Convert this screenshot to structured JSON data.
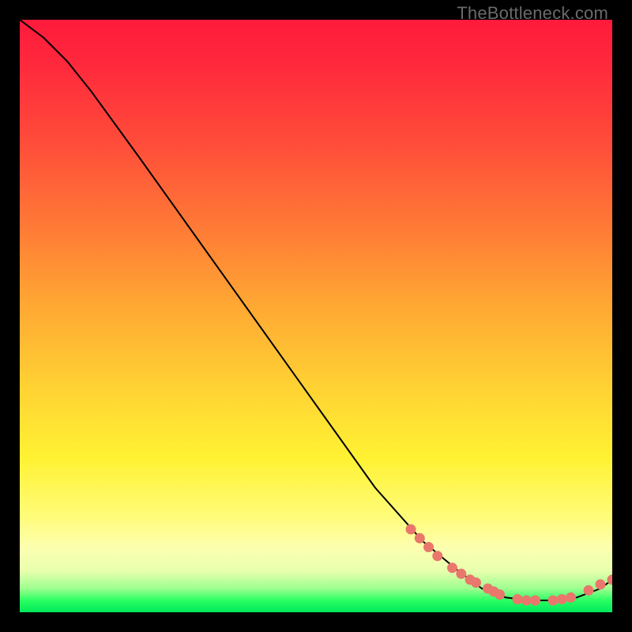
{
  "watermark": "TheBottleneck.com",
  "colors": {
    "curve": "#000000",
    "dot": "#e9776b",
    "gradient_top": "#ff1a3c",
    "gradient_bottom": "#00e85a"
  },
  "chart_data": {
    "type": "line",
    "title": "",
    "xlabel": "",
    "ylabel": "",
    "xlim": [
      0,
      100
    ],
    "ylim": [
      0,
      100
    ],
    "note": "Axis values are pixel-percent positions within the 750×750 plot (top-left origin, y increases downward). No tick labels are rendered.",
    "series": [
      {
        "name": "curve",
        "kind": "line",
        "x": [
          0,
          4,
          8,
          12,
          20,
          30,
          40,
          50,
          60,
          68,
          74,
          78,
          82,
          86,
          90,
          94,
          98,
          100
        ],
        "y": [
          0,
          3,
          7,
          12,
          23,
          37,
          51,
          65,
          79,
          88,
          93,
          96,
          97.5,
          98,
          98,
          97.5,
          96,
          94.5
        ]
      },
      {
        "name": "dotted-segment",
        "kind": "scatter",
        "x": [
          66,
          67.5,
          69,
          70.5,
          73,
          74.5,
          76,
          77,
          79,
          80,
          81,
          84,
          85.5,
          87,
          90,
          91.5,
          93,
          96,
          98,
          100
        ],
        "y": [
          86,
          87.5,
          89,
          90.5,
          92.5,
          93.5,
          94.5,
          95,
          96,
          96.5,
          97,
          97.8,
          98,
          98,
          98,
          97.8,
          97.5,
          96.3,
          95.3,
          94.5
        ]
      }
    ]
  }
}
